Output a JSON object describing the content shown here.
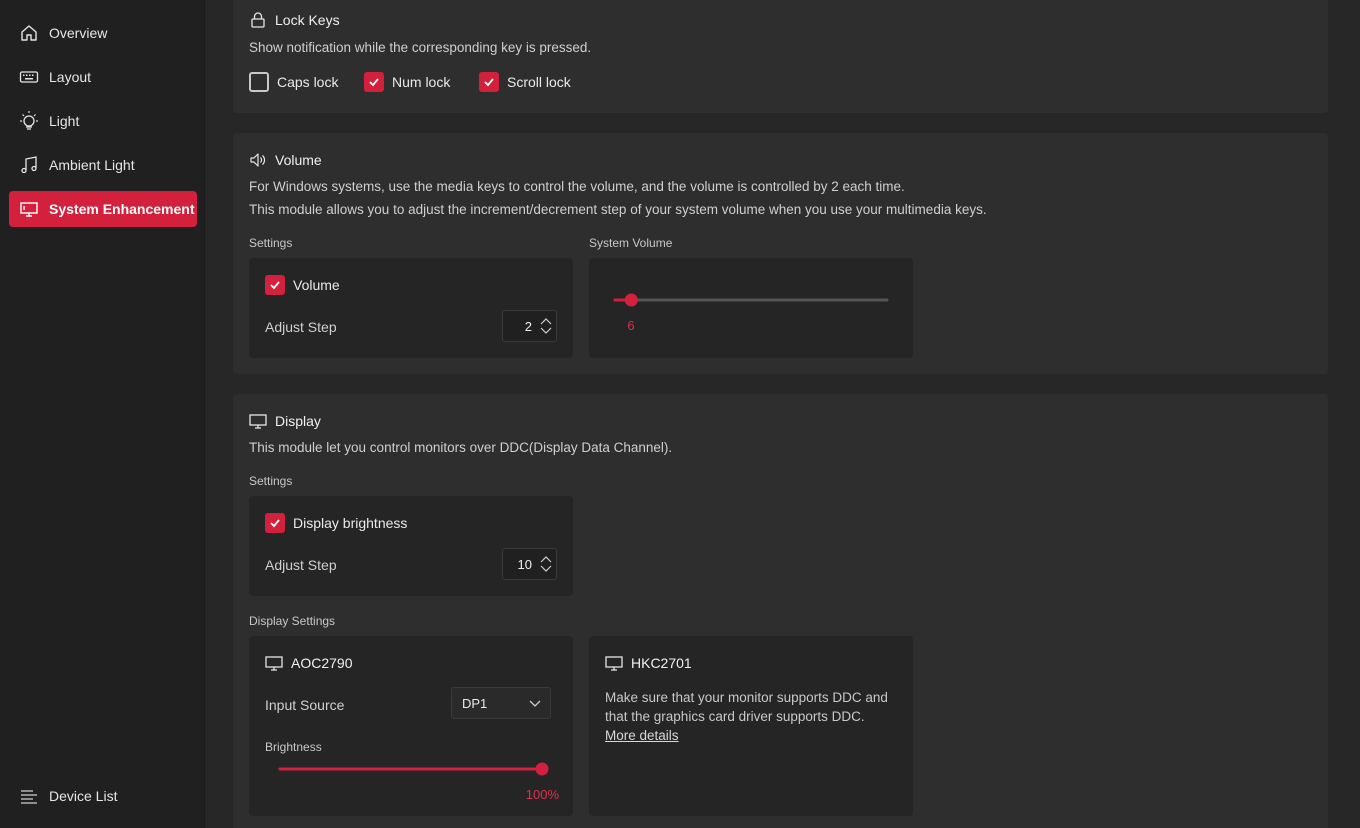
{
  "sidebar": {
    "items": [
      {
        "label": "Overview",
        "icon": "home-icon",
        "active": false
      },
      {
        "label": "Layout",
        "icon": "keyboard-icon",
        "active": false
      },
      {
        "label": "Light",
        "icon": "light-bulb-icon",
        "active": false
      },
      {
        "label": "Ambient Light",
        "icon": "music-note-icon",
        "active": false
      },
      {
        "label": "System Enhancement",
        "icon": "monitor-icon",
        "active": true
      }
    ],
    "footer": {
      "label": "Device List",
      "icon": "list-icon"
    }
  },
  "lock_keys": {
    "title": "Lock Keys",
    "description": "Show notification while the corresponding key is pressed.",
    "options": [
      {
        "label": "Caps lock",
        "checked": false
      },
      {
        "label": "Num lock",
        "checked": true
      },
      {
        "label": "Scroll lock",
        "checked": true
      }
    ]
  },
  "volume": {
    "title": "Volume",
    "description_1": "For Windows systems, use the media keys to control the volume, and the volume is controlled by 2 each time.",
    "description_2": "This module allows you to adjust the increment/decrement step of your system volume when you use your multimedia keys.",
    "settings_label": "Settings",
    "system_volume_label": "System Volume",
    "volume_checkbox_label": "Volume",
    "volume_checked": true,
    "adjust_step_label": "Adjust Step",
    "adjust_step_value": "2",
    "system_volume_value": "6",
    "system_volume_fraction": 0.06
  },
  "display": {
    "title": "Display",
    "description": "This module let you control monitors over DDC(Display Data Channel).",
    "settings_label": "Settings",
    "brightness_checkbox_label": "Display brightness",
    "brightness_checked": true,
    "adjust_step_label": "Adjust Step",
    "adjust_step_value": "10",
    "display_settings_label": "Display Settings",
    "monitors": [
      {
        "name": "AOC2790",
        "input_source_label": "Input Source",
        "input_source_value": "DP1",
        "brightness_label": "Brightness",
        "brightness_value": "100%",
        "brightness_fraction": 1.0
      },
      {
        "name": "HKC2701",
        "message": "Make sure that your monitor supports DDC and that the graphics card driver supports DDC.",
        "link": "More details"
      }
    ]
  },
  "colors": {
    "accent": "#d3213d",
    "background": "#272727",
    "card": "#2e2e2e"
  }
}
